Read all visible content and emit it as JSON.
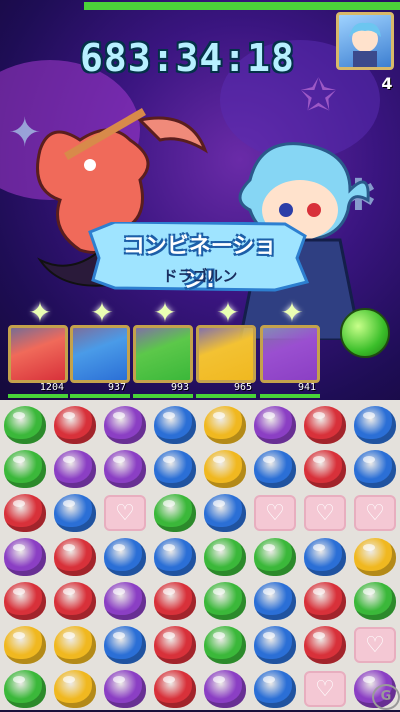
{
  "hud": {
    "player_hp_fraction": 1.0,
    "timer": "683:34:18",
    "enemy_turns": "4"
  },
  "combo": {
    "title": "コンビネーション!",
    "name": "ドラゴルン"
  },
  "cards": [
    {
      "color": "red",
      "hp": "1204"
    },
    {
      "color": "blue",
      "hp": "937"
    },
    {
      "color": "green",
      "hp": "993"
    },
    {
      "color": "yellow",
      "hp": "965"
    },
    {
      "color": "purple",
      "hp": "941"
    }
  ],
  "board": [
    [
      "green",
      "red",
      "purple",
      "blue",
      "yellow",
      "purple",
      "red",
      "blue"
    ],
    [
      "green",
      "purple",
      "purple",
      "blue",
      "yellow",
      "blue",
      "red",
      "blue"
    ],
    [
      "red",
      "blue",
      "heart",
      "green",
      "blue",
      "heart",
      "heart",
      "heart"
    ],
    [
      "purple",
      "red",
      "blue",
      "blue",
      "green",
      "green",
      "blue",
      "yellow"
    ],
    [
      "red",
      "red",
      "purple",
      "red",
      "green",
      "blue",
      "red",
      "green"
    ],
    [
      "yellow",
      "yellow",
      "blue",
      "red",
      "green",
      "blue",
      "red",
      "heart"
    ],
    [
      "green",
      "yellow",
      "purple",
      "red",
      "purple",
      "blue",
      "heart",
      "purple"
    ]
  ],
  "colors": {
    "red": "#d8313a",
    "blue": "#2b6fd6",
    "green": "#3bb83a",
    "yellow": "#f0b820",
    "purple": "#8b3fc4",
    "card_red": "#f06a5a",
    "card_blue": "#4a9be8",
    "card_green": "#5cc84a",
    "card_yellow": "#f3c233",
    "card_purple": "#9a4fd0"
  },
  "watermark": "G"
}
